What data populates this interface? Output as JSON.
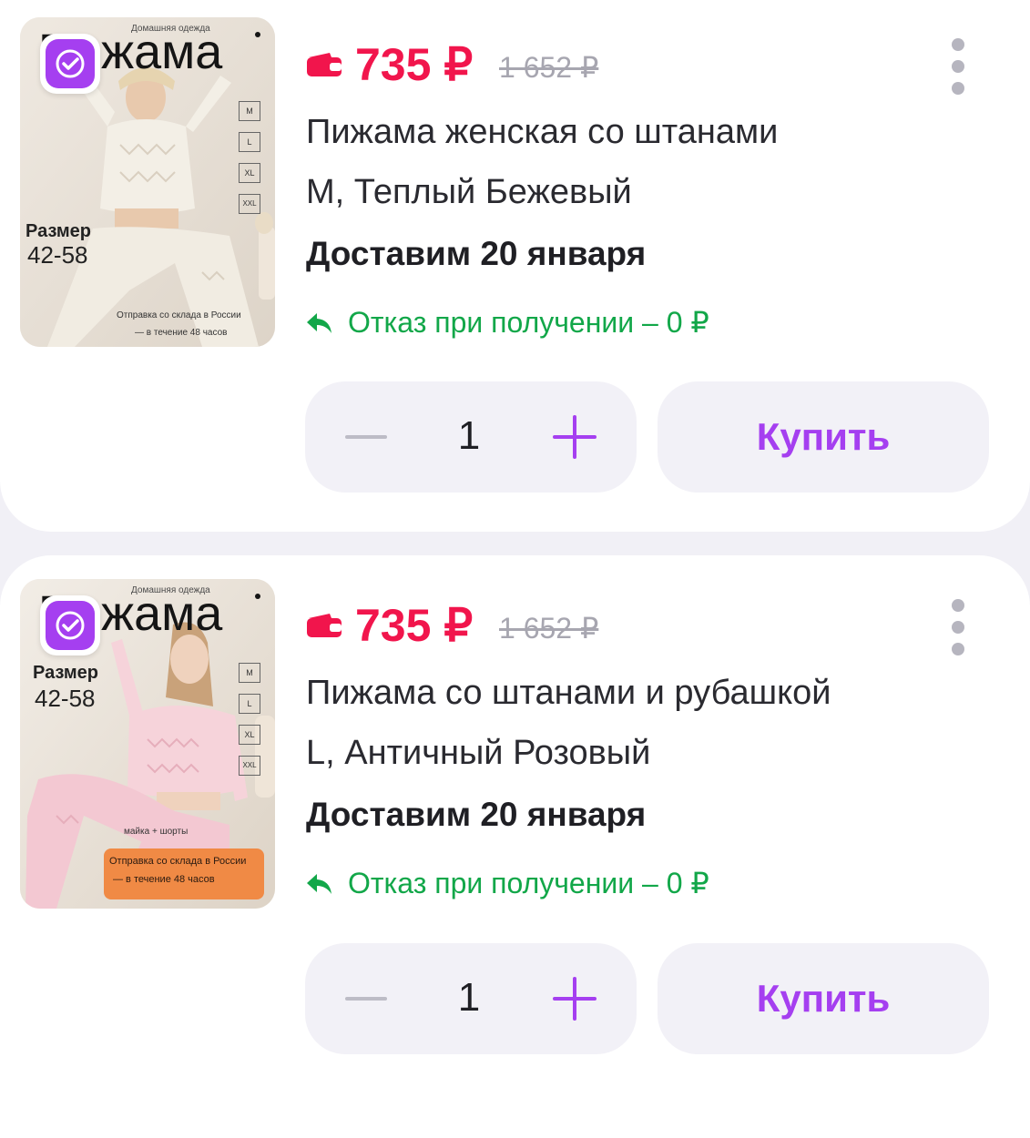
{
  "colors": {
    "accent": "#a53ff0",
    "price": "#f1154c",
    "refusal": "#12a749",
    "old_price": "#a7a6b0",
    "background": "#f1f0f6"
  },
  "items": [
    {
      "selected": true,
      "image": {
        "brand_small": "Домашняя одежда",
        "brand": "Пижама",
        "size_label": "Размер",
        "size_range": "42-58",
        "sizes": [
          "M",
          "L",
          "XL",
          "XXL"
        ],
        "shipping_line1": "Отправка со склада в России",
        "shipping_line2": "— в течение 48 часов",
        "extra": ""
      },
      "price": "735 ₽",
      "old_price": "1 652 ₽",
      "title": "Пижама женская со штанами",
      "variant": "M, Теплый Бежевый",
      "delivery": "Доставим 20 января",
      "refusal": "Отказ при получении – 0 ₽",
      "quantity": "1",
      "buy_label": "Купить",
      "icons": {
        "wallet": "wallet-icon",
        "refusal": "return-arrow-icon",
        "more": "more-vertical-icon",
        "check": "checkmark-icon"
      }
    },
    {
      "selected": true,
      "image": {
        "brand_small": "Домашняя одежда",
        "brand": "Пижама",
        "size_label": "Размер",
        "size_range": "42-58",
        "sizes": [
          "M",
          "L",
          "XL",
          "XXL"
        ],
        "shipping_line1": "Отправка со склада в России",
        "shipping_line2": "— в течение 48 часов",
        "extra": "майка + шорты"
      },
      "price": "735 ₽",
      "old_price": "1 652 ₽",
      "title": "Пижама со штанами и рубашкой",
      "variant": "L, Античный Розовый",
      "delivery": "Доставим 20 января",
      "refusal": "Отказ при получении – 0 ₽",
      "quantity": "1",
      "buy_label": "Купить",
      "icons": {
        "wallet": "wallet-icon",
        "refusal": "return-arrow-icon",
        "more": "more-vertical-icon",
        "check": "checkmark-icon"
      }
    }
  ]
}
